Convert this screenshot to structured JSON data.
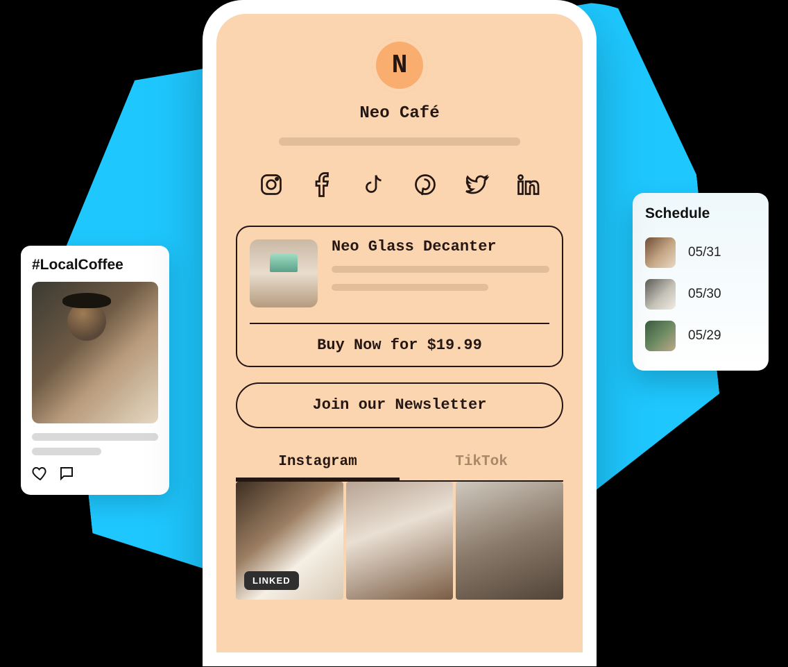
{
  "post": {
    "hashtag": "#LocalCoffee"
  },
  "schedule": {
    "title": "Schedule",
    "items": [
      {
        "date": "05/31"
      },
      {
        "date": "05/30"
      },
      {
        "date": "05/29"
      }
    ]
  },
  "profile": {
    "initial": "N",
    "name": "Neo Café"
  },
  "social_icons": [
    "instagram",
    "facebook",
    "tiktok",
    "pinterest",
    "twitter",
    "linkedin"
  ],
  "product": {
    "title": "Neo Glass Decanter",
    "buy_label": "Buy Now for $19.99"
  },
  "newsletter": {
    "label": "Join our Newsletter"
  },
  "tabs": {
    "active": "Instagram",
    "inactive": "TikTok"
  },
  "gallery": {
    "linked_badge": "LINKED"
  }
}
